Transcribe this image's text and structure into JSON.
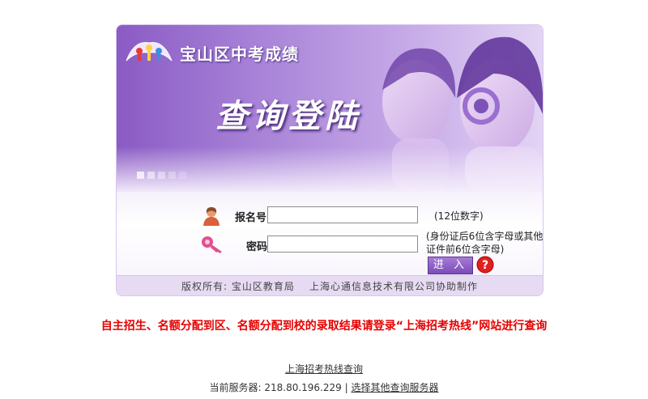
{
  "header": {
    "site_title": "宝山区中考成绩",
    "login_title": "查询登陆"
  },
  "form": {
    "username_label": "报名号:",
    "username_value": "",
    "username_hint": "(12位数字)",
    "password_label": "密码:",
    "password_value": "",
    "password_hint": "(身份证后6位含字母或其他证件前6位含字母)",
    "enter_label": "进 入"
  },
  "footer": {
    "copyright_label": "版权所有:",
    "owner": "宝山区教育局",
    "maker": "上海心通信息技术有限公司协助制作"
  },
  "notice": "自主招生、名额分配到区、名额分配到校的录取结果请登录“上海招考热线”网站进行查询",
  "links": {
    "hotline": "上海招考热线查询",
    "server_prefix": "当前服务器:",
    "server_ip": "218.80.196.229",
    "separator": "|",
    "choose_server": "选择其他查询服务器"
  },
  "colors": {
    "accent": "#8a5bc4",
    "notice": "#e60000"
  }
}
